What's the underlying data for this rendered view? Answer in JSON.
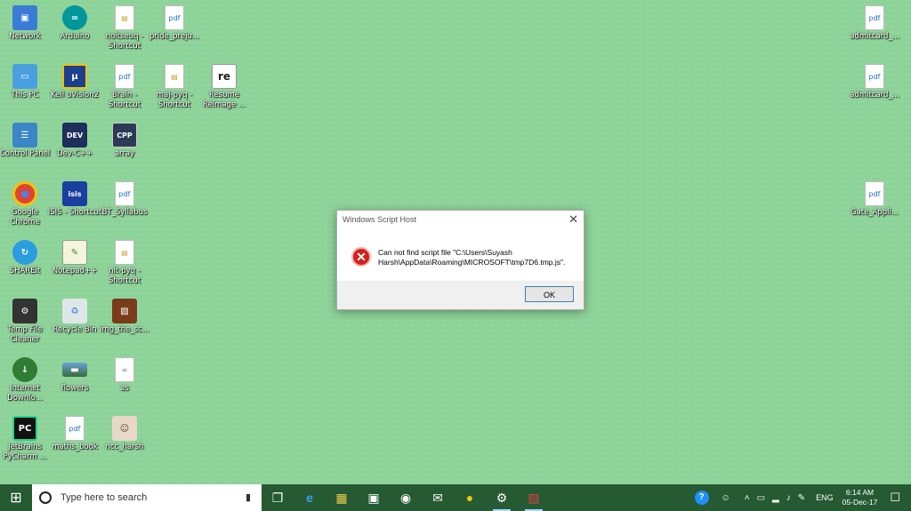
{
  "desktop": {
    "icons": [
      {
        "label": "Network",
        "glyph": "▣"
      },
      {
        "label": "Arduino",
        "glyph": "∞"
      },
      {
        "label": "noitseuq - Shortcut",
        "glyph": "▤"
      },
      {
        "label": "pride_preju...",
        "glyph": "pdf"
      },
      {
        "label": "This PC",
        "glyph": "▭"
      },
      {
        "label": "Keil uVision2",
        "glyph": "μ"
      },
      {
        "label": "Brain - Shortcut",
        "glyph": "pdf"
      },
      {
        "label": "maj-pyq - Shortcut",
        "glyph": "▤"
      },
      {
        "label": "Resume Reimage ...",
        "glyph": "re"
      },
      {
        "label": "Control Panel",
        "glyph": "☰"
      },
      {
        "label": "Dev-C++",
        "glyph": "DEV"
      },
      {
        "label": "array",
        "glyph": "CPP"
      },
      {
        "label": "Google Chrome",
        "glyph": "●"
      },
      {
        "label": "ISIS - Shortcut",
        "glyph": "isis"
      },
      {
        "label": "BT_Syllabus",
        "glyph": "pdf"
      },
      {
        "label": "SHAREit",
        "glyph": "↻"
      },
      {
        "label": "Notepad++",
        "glyph": "✎"
      },
      {
        "label": "nit-pyq - Shortcut",
        "glyph": "▤"
      },
      {
        "label": "Temp File Cleaner",
        "glyph": "⚙"
      },
      {
        "label": "Recycle Bin",
        "glyph": "♻"
      },
      {
        "label": "img_the_sc...",
        "glyph": "▨"
      },
      {
        "label": "Internet Downlo...",
        "glyph": "↓"
      },
      {
        "label": "flowers",
        "glyph": "▬"
      },
      {
        "label": "as",
        "glyph": "≡"
      },
      {
        "label": "JetBrains PyCharm ...",
        "glyph": "PC"
      },
      {
        "label": "maths_book",
        "glyph": "pdf"
      },
      {
        "label": "ncc_harsh",
        "glyph": "☺"
      },
      {
        "label": "admitcard_...",
        "glyph": "pdf"
      },
      {
        "label": "admitcard_...",
        "glyph": "pdf"
      },
      {
        "label": "Gate_Appli...",
        "glyph": "pdf"
      }
    ]
  },
  "dialog": {
    "title": "Windows Script Host",
    "close_glyph": "✕",
    "error_glyph": "✕",
    "message": "Can not find script file \"C:\\Users\\Suyash Harsh\\AppData\\Roaming\\MICROSOFT\\tmp7D6.tmp.js\".",
    "ok_label": "OK"
  },
  "taskbar": {
    "start_glyph": "⊞",
    "search_placeholder": "Type here to search",
    "mic_glyph": "▮",
    "apps": [
      {
        "glyph": "❐"
      },
      {
        "glyph": "e"
      },
      {
        "glyph": "▦"
      },
      {
        "glyph": "▣"
      },
      {
        "glyph": "◉"
      },
      {
        "glyph": "✉"
      },
      {
        "glyph": "●"
      },
      {
        "glyph": "⚙"
      },
      {
        "glyph": "▧"
      }
    ],
    "tray": {
      "help_glyph": "?",
      "people_glyph": "☺",
      "chevron_glyph": "˄",
      "battery_glyph": "▭",
      "network_glyph": "▂",
      "volume_glyph": "♪",
      "pen_glyph": "✎",
      "language": "ENG",
      "time": "6:14 AM",
      "date": "05-Dec-17",
      "notification_glyph": "☐"
    }
  }
}
